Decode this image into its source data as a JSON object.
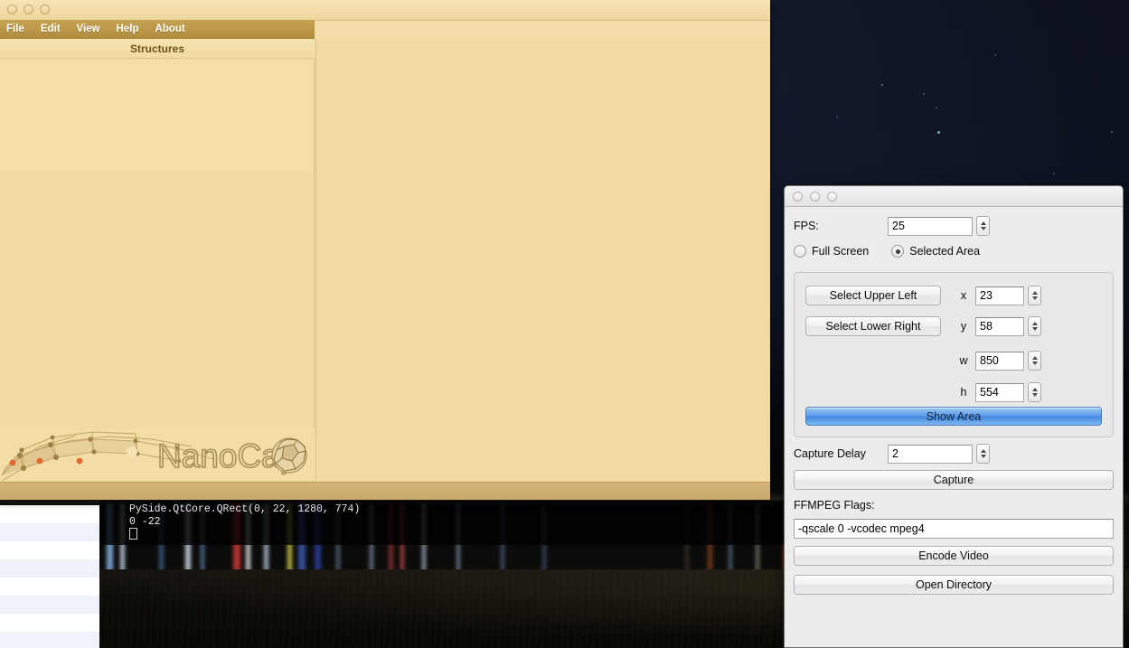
{
  "desktop": {
    "terminal": {
      "line1": "PySide.QtCore.QRect(0, 22, 1280, 774)",
      "line2": "0 -22"
    }
  },
  "nanocap": {
    "window_title": "NanoCap",
    "menu": [
      {
        "label": "File"
      },
      {
        "label": "Edit"
      },
      {
        "label": "View"
      },
      {
        "label": "Help"
      },
      {
        "label": "About"
      }
    ],
    "panel_header": "Structures",
    "logo_text": "NanoCap",
    "traffic_lights": [
      "close-button",
      "minimize-button",
      "zoom-button"
    ]
  },
  "capture": {
    "traffic_lights": [
      "close-button",
      "minimize-button",
      "zoom-button"
    ],
    "fps": {
      "label": "FPS:",
      "value": "25"
    },
    "mode": {
      "full_screen": {
        "label": "Full Screen",
        "selected": false
      },
      "selected_area": {
        "label": "Selected Area",
        "selected": true
      }
    },
    "area": {
      "select_upper_left": "Select Upper Left",
      "select_lower_right": "Select Lower Right",
      "x": {
        "label": "x",
        "value": "23"
      },
      "y": {
        "label": "y",
        "value": "58"
      },
      "w": {
        "label": "w",
        "value": "850"
      },
      "h": {
        "label": "h",
        "value": "554"
      },
      "show_area": "Show Area"
    },
    "capture_delay": {
      "label": "Capture Delay",
      "value": "2"
    },
    "capture_button": "Capture",
    "ffmpeg": {
      "label": "FFMPEG Flags:",
      "value": "-qscale 0 -vcodec mpeg4"
    },
    "encode_video_button": "Encode Video",
    "open_directory_button": "Open Directory"
  },
  "colors": {
    "nanocap_bg": "#f2dda8",
    "nanocap_menubar": "#bb9748",
    "dialog_bg": "#ececec",
    "default_button_blue": "#5d9ce8",
    "terminal_text": "#f2f2f2"
  }
}
